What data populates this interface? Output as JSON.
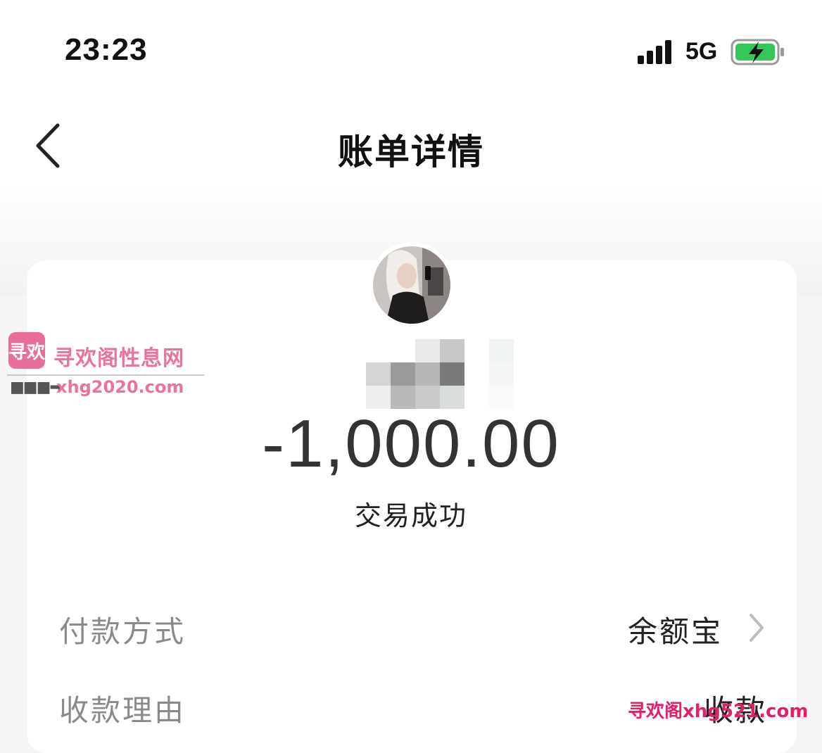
{
  "status_bar": {
    "time": "23:23",
    "network": "5G",
    "battery_charging": true
  },
  "nav": {
    "title": "账单详情"
  },
  "transaction": {
    "amount": "-1,000.00",
    "status": "交易成功"
  },
  "details": [
    {
      "label": "付款方式",
      "value": "余额宝",
      "has_chevron": true
    },
    {
      "label": "收款理由",
      "value": "收款"
    }
  ],
  "watermarks": {
    "site_name": "寻欢阁性息网",
    "logo_text": "寻欢",
    "url": "xhg2020.com",
    "footer": "寻欢阁xhg521.com"
  },
  "colors": {
    "accent_battery": "#34c759",
    "watermark": "#e9739a"
  }
}
